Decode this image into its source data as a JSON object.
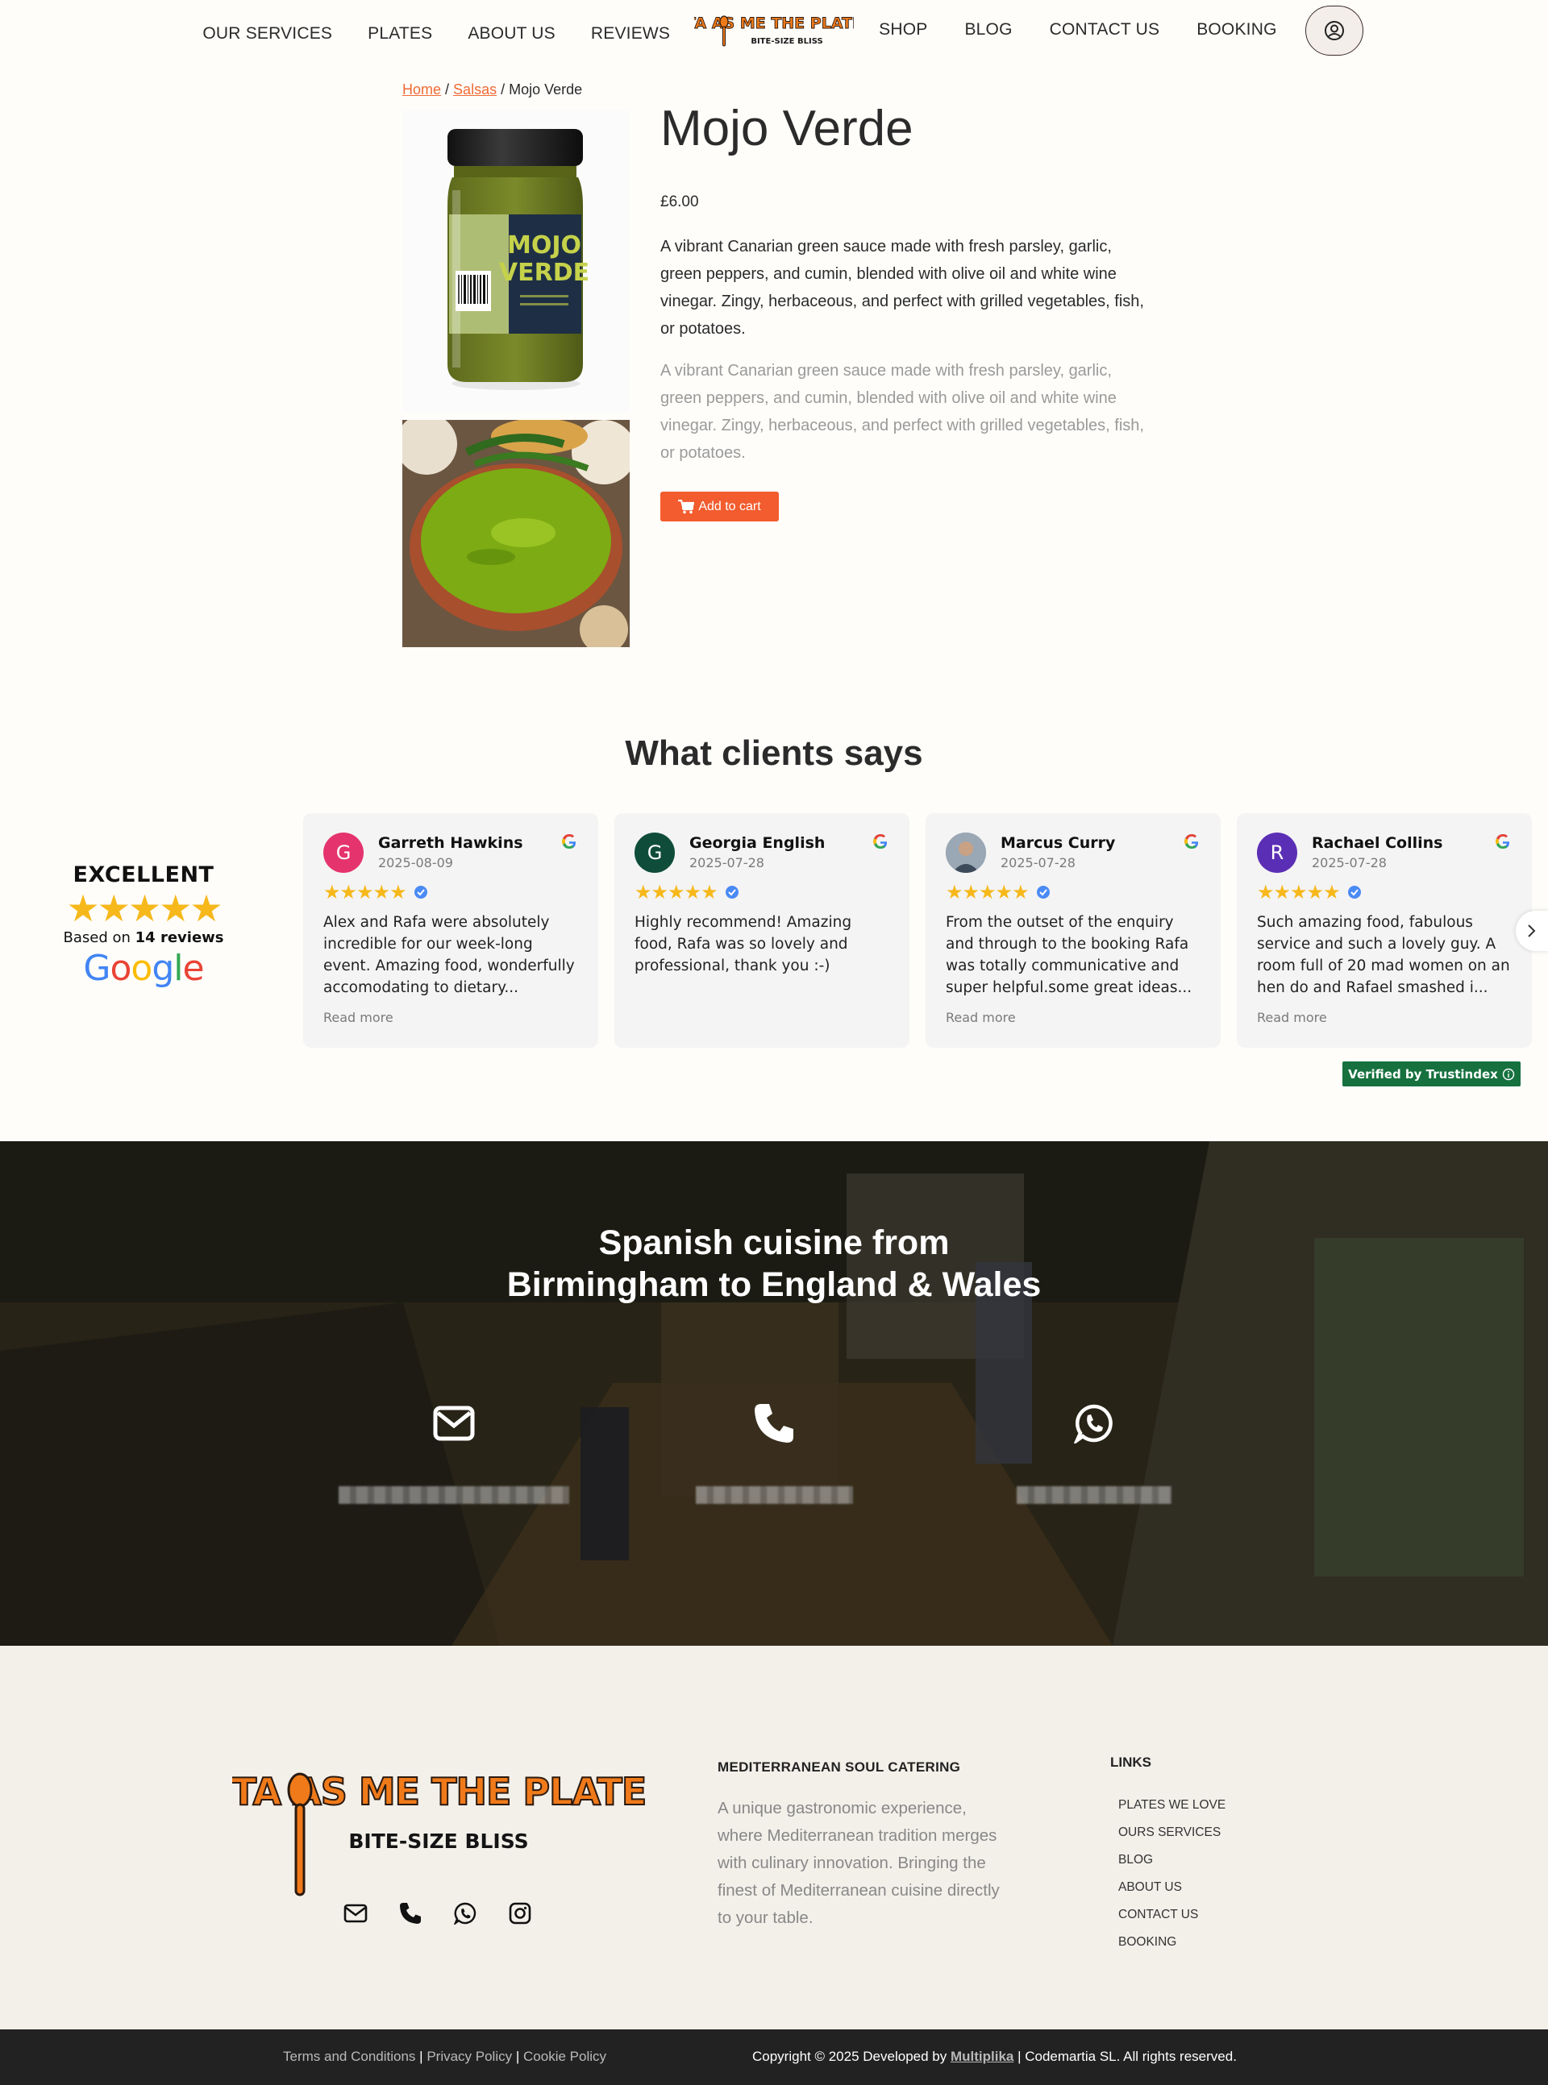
{
  "nav": {
    "left": [
      "OUR SERVICES",
      "PLATES",
      "ABOUT US",
      "REVIEWS"
    ],
    "right": [
      "SHOP",
      "BLOG",
      "CONTACT US",
      "BOOKING"
    ],
    "account_icon": "user-circle-icon"
  },
  "brand": {
    "name": "TAPAS ME THE PLATE",
    "tagline": "BITE-SIZE BLISS",
    "colors": {
      "orange": "#f07a1a",
      "accent": "#f25c2e",
      "dark": "#222222"
    }
  },
  "breadcrumb": {
    "home": "Home",
    "category": "Salsas",
    "current": "Mojo Verde"
  },
  "product": {
    "title": "Mojo Verde",
    "price": "£6.00",
    "description": "A vibrant Canarian green sauce made with fresh parsley, garlic, green peppers, and cumin, blended with olive oil and white wine vinegar. Zingy, herbaceous, and perfect with grilled vegetables, fish, or potatoes.",
    "description_repeat": "A vibrant Canarian green sauce made with fresh parsley, garlic, green peppers, and cumin, blended with olive oil and white wine vinegar. Zingy, herbaceous, and perfect with grilled vegetables, fish, or potatoes.",
    "add_to_cart": "Add to cart",
    "jar_label": {
      "top": "MOJO",
      "bottom": "VERDE"
    }
  },
  "reviews": {
    "heading": "What clients says",
    "summary": {
      "word": "EXCELLENT",
      "based_prefix": "Based on",
      "count": "14 reviews",
      "provider": "Google"
    },
    "read_more": "Read more",
    "items": [
      {
        "initial": "G",
        "color": "#e5336d",
        "name": "Garreth Hawkins",
        "date": "2025-08-09",
        "text": "Alex and Rafa were absolutely incredible for our week-long event. Amazing food, wonderfully accomodating to dietary...",
        "read_more": true
      },
      {
        "initial": "G",
        "color": "#0f4d3a",
        "name": "Georgia English",
        "date": "2025-07-28",
        "text": "Highly recommend! Amazing food, Rafa was so lovely and professional, thank you :-)",
        "read_more": false
      },
      {
        "initial": "",
        "color": "#7d8a9a",
        "name": "Marcus Curry",
        "date": "2025-07-28",
        "text": "From the outset of the enquiry and through to the booking Rafa was totally communicative and super helpful.some great ideas...",
        "read_more": true
      },
      {
        "initial": "R",
        "color": "#5b2fb5",
        "name": "Rachael Collins",
        "date": "2025-07-28",
        "text": "Such amazing food, fabulous service and such a lovely guy. A room full of 20 mad women on an hen do and Rafael smashed i...",
        "read_more": true
      }
    ],
    "verified": "Verified by Trustindex"
  },
  "banner": {
    "line1": "Spanish cuisine from",
    "line2": "Birmingham to England & Wales",
    "contacts": [
      {
        "icon": "envelope-icon",
        "value": "████████████████████"
      },
      {
        "icon": "phone-icon",
        "value": "██████████"
      },
      {
        "icon": "whatsapp-icon",
        "value": "██████████"
      }
    ]
  },
  "footer": {
    "about_title": "MEDITERRANEAN SOUL CATERING",
    "about_text": "A unique gastronomic experience, where Mediterranean tradition merges with culinary innovation. Bringing the finest of Mediterranean cuisine directly to your table.",
    "links_title": "LINKS",
    "links": [
      "PLATES WE LOVE",
      "OURS SERVICES",
      "BLOG",
      "ABOUT US",
      "CONTACT US",
      "BOOKING"
    ],
    "social_icons": [
      "envelope-icon",
      "phone-icon",
      "whatsapp-icon",
      "instagram-icon"
    ],
    "legal": {
      "terms": "Terms and Conditions",
      "sep": "|",
      "privacy": "Privacy Policy",
      "cookie": "Cookie Policy"
    },
    "copyright_prefix": "Copyright © 2025 Developed by",
    "developer": "Multiplika",
    "copyright_suffix": "| Codemartia SL. All rights reserved."
  }
}
